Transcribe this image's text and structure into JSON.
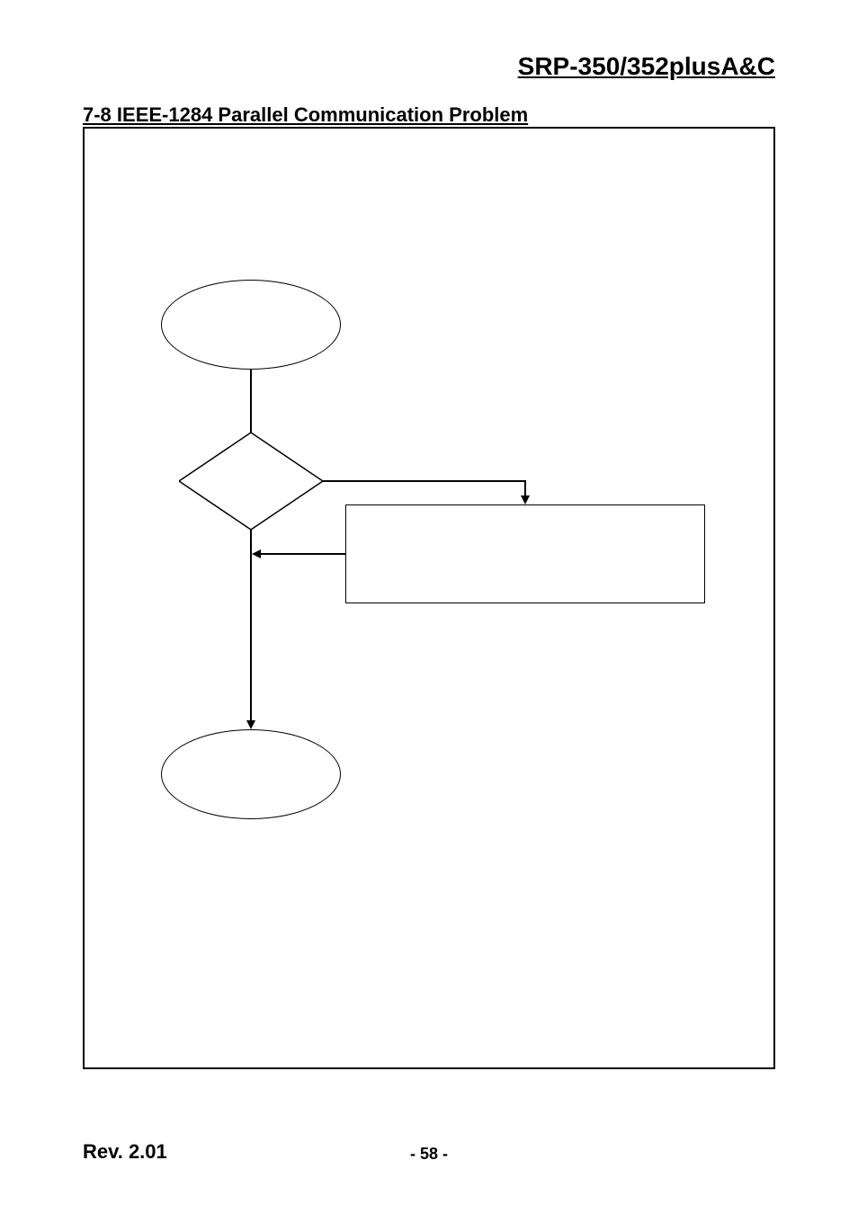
{
  "header": {
    "page_title": "SRP-350/352plusA&C"
  },
  "section": {
    "title": "7-8 IEEE-1284 Parallel Communication Problem"
  },
  "footer": {
    "rev": "Rev. 2.01",
    "page_number": "- 58 -"
  }
}
